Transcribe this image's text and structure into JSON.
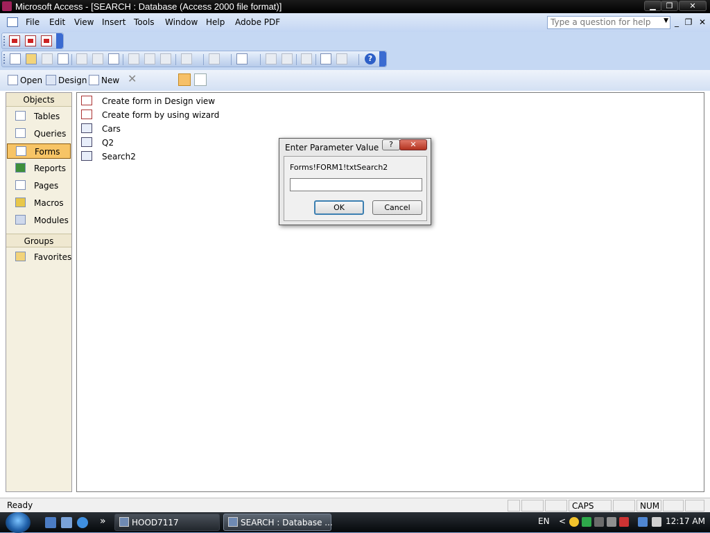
{
  "window": {
    "title": "Microsoft Access - [SEARCH : Database (Access 2000 file format)]",
    "controls": {
      "minimize": "▁",
      "restore": "❐",
      "close": "✕"
    }
  },
  "menubar": {
    "items": [
      "File",
      "Edit",
      "View",
      "Insert",
      "Tools",
      "Window",
      "Help",
      "Adobe PDF"
    ],
    "help_placeholder": "Type a question for help",
    "mdi": {
      "minimize": "_",
      "restore": "❐",
      "close": "✕"
    }
  },
  "db_toolbar": {
    "open": "Open",
    "design": "Design",
    "new": "New",
    "delete": "✕"
  },
  "objects": {
    "header": "Objects",
    "items": [
      "Tables",
      "Queries",
      "Forms",
      "Reports",
      "Pages",
      "Macros",
      "Modules"
    ],
    "selected": "Forms",
    "groups_header": "Groups",
    "groups": [
      "Favorites"
    ]
  },
  "list": {
    "items": [
      "Create form in Design view",
      "Create form by using wizard",
      "Cars",
      "Q2",
      "Search2"
    ]
  },
  "dialog": {
    "title": "Enter Parameter Value",
    "help_button": "?",
    "close_button": "✕",
    "prompt": "Forms!FORM1!txtSearch2",
    "value": "",
    "ok": "OK",
    "cancel": "Cancel"
  },
  "statusbar": {
    "text": "Ready",
    "caps": "CAPS",
    "num": "NUM"
  },
  "taskbar": {
    "chevron": "»",
    "tasks": [
      "HOOD7117",
      "SEARCH : Database ..."
    ],
    "lang": "EN",
    "tray_chevron": "<",
    "clock": "12:17 AM"
  },
  "colors": {
    "selected_object": "#f7c466",
    "toolbar": "#c5d8f3",
    "menubar": "#d3e2f7"
  }
}
